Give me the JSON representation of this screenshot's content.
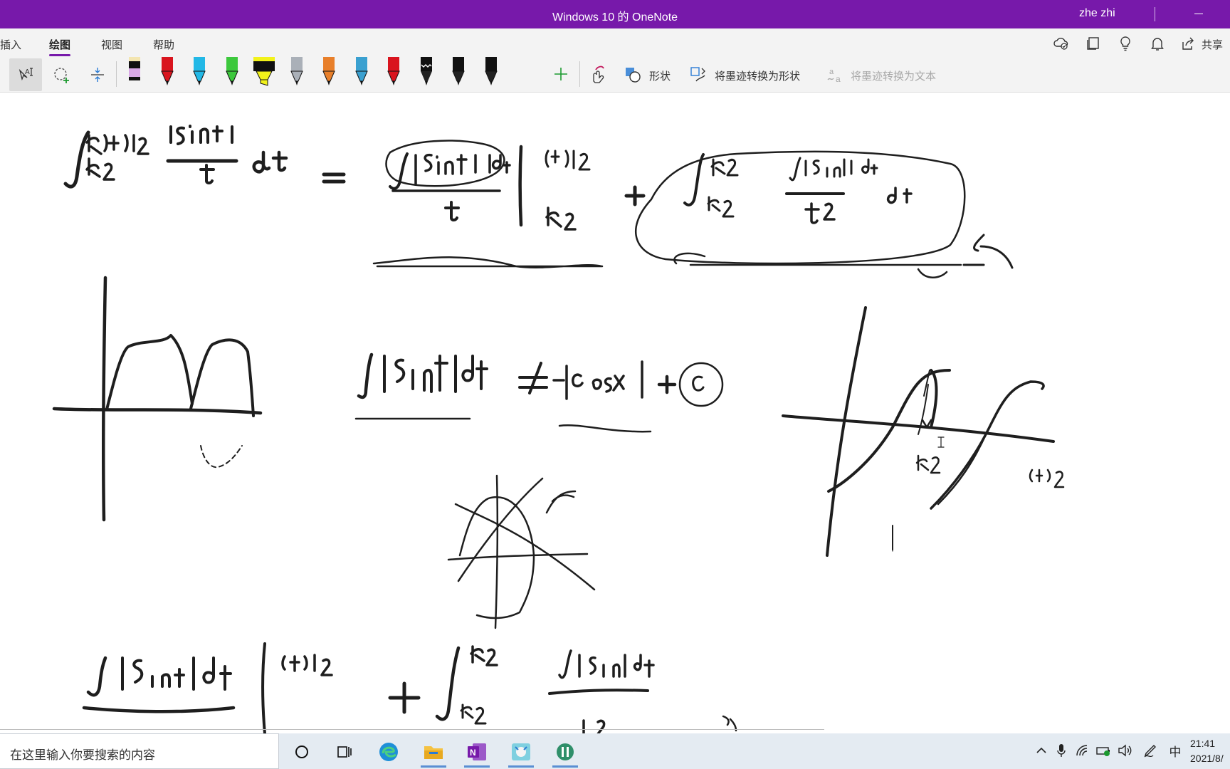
{
  "window": {
    "title": "Windows 10 的 OneNote",
    "user": "zhe zhi"
  },
  "ribbon_tabs": [
    {
      "label": "插入",
      "active": false
    },
    {
      "label": "绘图",
      "active": true
    },
    {
      "label": "视图",
      "active": false
    },
    {
      "label": "帮助",
      "active": false
    }
  ],
  "right_icons": [
    "sync-status-icon",
    "notebooks-icon",
    "lightbulb-icon",
    "bell-icon",
    "share-icon"
  ],
  "share_label": "共享",
  "pens": [
    {
      "color": "#111111",
      "band": "#e0b8e8",
      "type": "pen"
    },
    {
      "color": "#d9141e",
      "band": "#d9141e",
      "type": "pen"
    },
    {
      "color": "#22b8e6",
      "band": "#22b8e6",
      "type": "pen"
    },
    {
      "color": "#3cc83c",
      "band": "#3cc83c",
      "type": "pen"
    },
    {
      "color": "#f2f21a",
      "band": "#f2f21a",
      "type": "highlighter"
    },
    {
      "color": "#aab0b8",
      "band": "#aab0b8",
      "type": "pen"
    },
    {
      "color": "#e87f2a",
      "band": "#e87f2a",
      "type": "pen"
    },
    {
      "color": "#3aa0d0",
      "band": "#3aa0d0",
      "type": "pen"
    },
    {
      "color": "#d9141e",
      "band": "#d9141e",
      "type": "pen"
    },
    {
      "color": "#111111",
      "band": "#ffffff",
      "type": "pen"
    },
    {
      "color": "#111111",
      "band": "#111111",
      "type": "pen"
    },
    {
      "color": "#111111",
      "band": "#111111",
      "type": "pen"
    }
  ],
  "toolbar": {
    "shapes_label": "形状",
    "ink_to_shape_label": "将墨迹转换为形状",
    "ink_to_text_label": "将墨迹转换为文本"
  },
  "taskbar": {
    "search_placeholder": "在这里输入你要搜索的内容",
    "apps": [
      "cortana",
      "task-view",
      "edge",
      "file-explorer",
      "onenote",
      "app-1",
      "app-2"
    ],
    "ime": "中",
    "time": "21:41",
    "date": "2021/8/"
  },
  "colors": {
    "accent": "#7719aa",
    "ink": "#1e1e1e"
  }
}
